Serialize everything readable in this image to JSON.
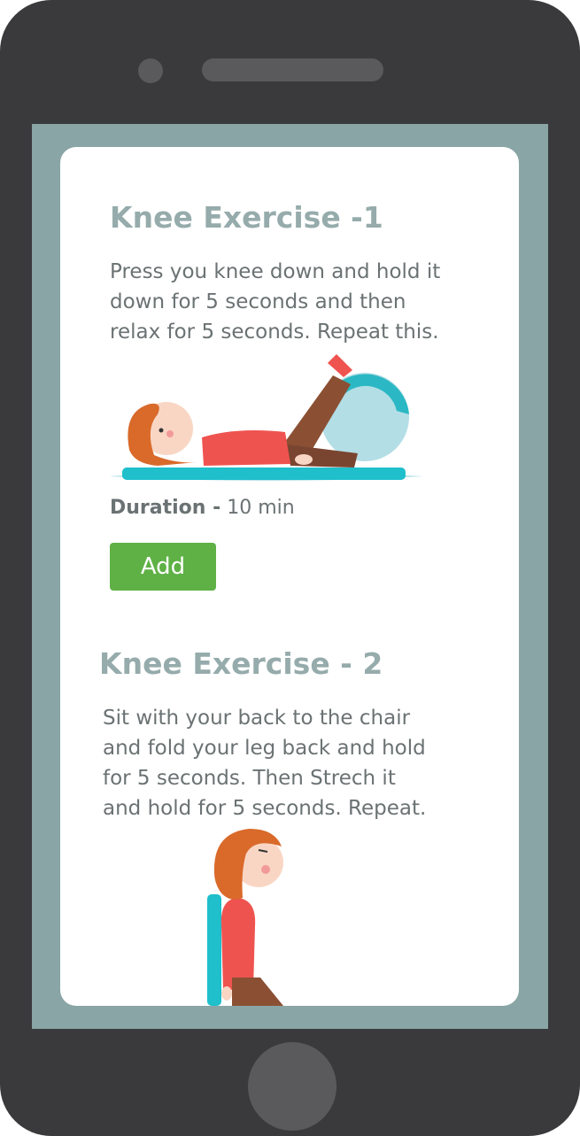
{
  "exercises": [
    {
      "title": "Knee Exercise -1",
      "description": "Press you knee down and hold it\ndown for 5 seconds and then\nrelax for 5 seconds. Repeat this.",
      "duration_label": "Duration -",
      "duration_value": "10 min",
      "add_label": "Add",
      "illustration": "person-lying-leg-on-ball"
    },
    {
      "title": "Knee Exercise - 2",
      "description": "Sit with your back to the chair\nand fold your leg back and hold\nfor 5 seconds. Then Strech it\nand hold for 5 seconds. Repeat.",
      "illustration": "person-seated-on-chair"
    }
  ],
  "colors": {
    "phone_body": "#3a3a3c",
    "screen_background": "#89a5a5",
    "title_text": "#96abab",
    "body_text": "#6b7273",
    "add_button": "#5fb146",
    "scroll_thumb": "#9bb1ae",
    "mat": "#1fbfcb",
    "ball": "#b3dee6",
    "shirt": "#ef5350",
    "hair": "#d96a2a",
    "pants": "#8b5034"
  },
  "icons": [
    "camera-icon",
    "speaker-icon",
    "home-button-icon"
  ]
}
